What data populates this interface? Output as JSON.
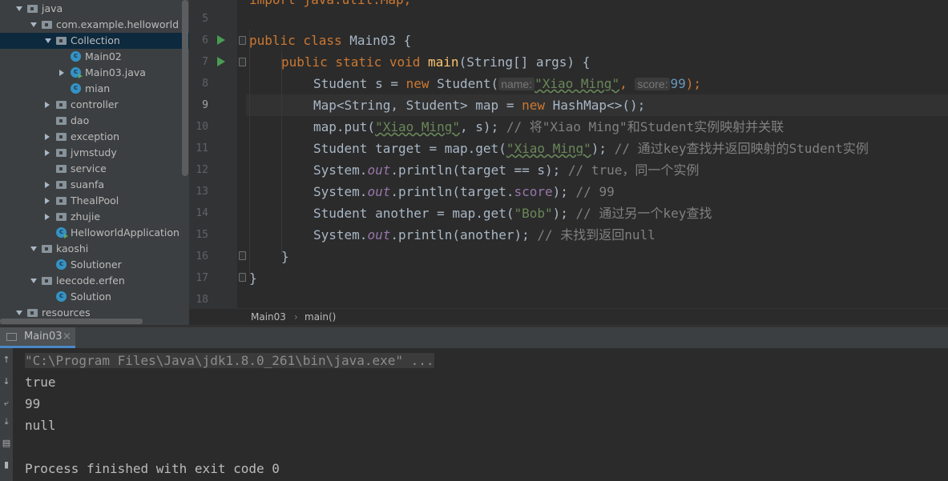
{
  "project_tree": [
    {
      "label": "java",
      "expanded": true,
      "type": "folder"
    },
    {
      "label": "com.example.helloworld",
      "expanded": true,
      "type": "package"
    },
    {
      "label": "Collection",
      "expanded": true,
      "type": "package",
      "selected": true
    },
    {
      "label": "Main02",
      "type": "class"
    },
    {
      "label": "Main03.java",
      "expanded": false,
      "type": "class"
    },
    {
      "label": "mian",
      "type": "class"
    },
    {
      "label": "controller",
      "expanded": false,
      "type": "package"
    },
    {
      "label": "dao",
      "type": "package"
    },
    {
      "label": "exception",
      "expanded": false,
      "type": "package"
    },
    {
      "label": "jvmstudy",
      "expanded": false,
      "type": "package"
    },
    {
      "label": "service",
      "type": "package"
    },
    {
      "label": "suanfa",
      "expanded": false,
      "type": "package"
    },
    {
      "label": "ThealPool",
      "expanded": false,
      "type": "package"
    },
    {
      "label": "zhujie",
      "expanded": false,
      "type": "package"
    },
    {
      "label": "HelloworldApplication",
      "type": "class"
    },
    {
      "label": "kaoshi",
      "expanded": true,
      "type": "package"
    },
    {
      "label": "Solutioner",
      "type": "class"
    },
    {
      "label": "leecode.erfen",
      "expanded": true,
      "type": "package"
    },
    {
      "label": "Solution",
      "type": "class"
    },
    {
      "label": "resources",
      "expanded": true,
      "type": "folder"
    }
  ],
  "editor": {
    "line_numbers": [
      "5",
      "6",
      "7",
      "8",
      "9",
      "10",
      "11",
      "12",
      "13",
      "14",
      "15",
      "16",
      "17",
      "18"
    ],
    "current_line": "9",
    "lines": {
      "l6": {
        "kw1": "public class ",
        "name": "Main03 {"
      },
      "l7": {
        "kw1": "public static void ",
        "fn": "main",
        "rest": "(String[] args) {"
      },
      "l8": {
        "a": "Student s = ",
        "kw": "new ",
        "b": "Student(",
        "hint1": "name:",
        "s1": "\"Xiao Ming\"",
        "c": ", ",
        "hint2": "score:",
        "n": "99",
        "d": ");"
      },
      "l9": {
        "a": "Map<String, Student> map = ",
        "kw": "new ",
        "b": "HashMap<>();"
      },
      "l10": {
        "a": "map.put(",
        "s": "\"Xiao Ming\"",
        "b": ", s); ",
        "cm": "// 将\"Xiao Ming\"和Student实例映射并关联"
      },
      "l11": {
        "a": "Student target = map.get(",
        "s": "\"Xiao Ming\"",
        "b": "); ",
        "cm": "// 通过key查找并返回映射的Student实例"
      },
      "l12": {
        "a": "System.",
        "f": "out",
        "b": ".println(target == s); ",
        "cm": "// true，同一个实例"
      },
      "l13": {
        "a": "System.",
        "f": "out",
        "b": ".println(target.",
        "fld": "score",
        "c": "); ",
        "cm": "// 99"
      },
      "l14": {
        "a": "Student another = map.get(",
        "s": "\"Bob\"",
        "b": "); ",
        "cm": "// 通过另一个key查找"
      },
      "l15": {
        "a": "System.",
        "f": "out",
        "b": ".println(another); ",
        "cm": "// 未找到返回null"
      },
      "l16": {
        "a": "}"
      },
      "l17": {
        "a": "}"
      },
      "l5": {
        "a": "import java.util.Map;"
      }
    }
  },
  "breadcrumb": {
    "item1": "Main03",
    "sep": "›",
    "item2": "main()"
  },
  "run_panel": {
    "tab_label": "Main03",
    "close": "×",
    "console": [
      "\"C:\\Program Files\\Java\\jdk1.8.0_261\\bin\\java.exe\" ...",
      "true",
      "99",
      "null",
      "",
      "Process finished with exit code 0"
    ]
  },
  "colors": {
    "accent": "#4a88c7",
    "keyword": "#cc7832",
    "string": "#6a8759",
    "number": "#6897bb",
    "method": "#ffc66d",
    "comment": "#808080"
  }
}
